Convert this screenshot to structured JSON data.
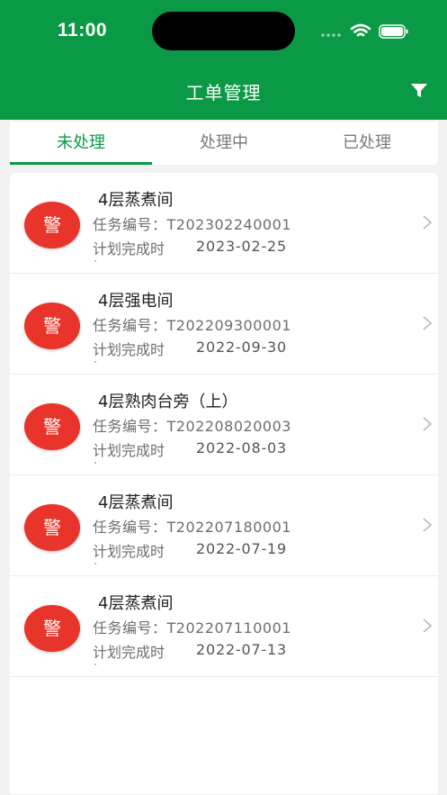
{
  "status_bar": {
    "time": "11:00"
  },
  "header": {
    "title": "工单管理"
  },
  "tabs": [
    {
      "label": "未处理",
      "active": true
    },
    {
      "label": "处理中",
      "active": false
    },
    {
      "label": "已处理",
      "active": false
    }
  ],
  "list": {
    "items": [
      {
        "badge": "警",
        "location": "4层蒸煮间",
        "code": "任务编号：T202302240001",
        "plan_label": "计划完成时",
        "plan_date": "2023-02-25"
      },
      {
        "badge": "警",
        "location": "4层强电间",
        "code": "任务编号：T202209300001",
        "plan_label": "计划完成时",
        "plan_date": "2022-09-30"
      },
      {
        "badge": "警",
        "location": "4层熟肉台旁（上）",
        "code": "任务编号：T202208020003",
        "plan_label": "计划完成时",
        "plan_date": "2022-08-03"
      },
      {
        "badge": "警",
        "location": "4层蒸煮间",
        "code": "任务编号：T202207180001",
        "plan_label": "计划完成时",
        "plan_date": "2022-07-19"
      },
      {
        "badge": "警",
        "location": "4层蒸煮间",
        "code": "任务编号：T202207110001",
        "plan_label": "计划完成时",
        "plan_date": "2022-07-13"
      }
    ]
  },
  "colors": {
    "brand": "#0a9a45",
    "alert": "#e8342a"
  },
  "icons": [
    "filter-icon",
    "wifi-icon",
    "battery-icon",
    "cellular-icon",
    "chevron-right-icon"
  ]
}
